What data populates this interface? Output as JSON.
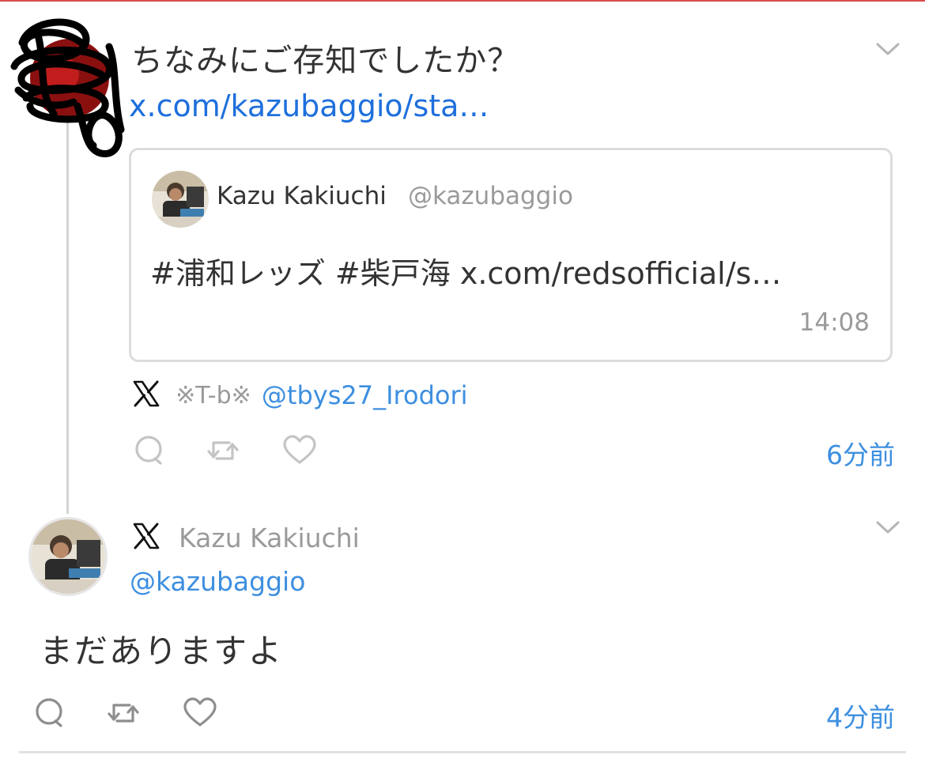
{
  "tweet1": {
    "text": "ちなみにご存知でしたか？",
    "link": "x.com/kazubaggio/sta…",
    "quote": {
      "author_name": "Kazu Kakiuchi",
      "author_handle": "@kazubaggio",
      "text": "#浦和レッズ #柴戸海 x.com/redsofficial/s…",
      "time": "14:08"
    },
    "source_name": "※T-b※",
    "source_handle": "@tbys27_Irodori",
    "timeago": "6分前"
  },
  "tweet2": {
    "author_name": "Kazu Kakiuchi",
    "author_handle": "@kazubaggio",
    "text": "まだありますよ",
    "timeago": "4分前"
  },
  "icons": {
    "reply": "reply-icon",
    "retweet": "retweet-icon",
    "like": "heart-icon",
    "menu": "chevron-down-icon",
    "platform": "x-logo-icon"
  },
  "colors": {
    "link": "#1e6fdc",
    "accent": "#3d8fe0",
    "muted": "#9a9a9a",
    "text": "#333333"
  }
}
